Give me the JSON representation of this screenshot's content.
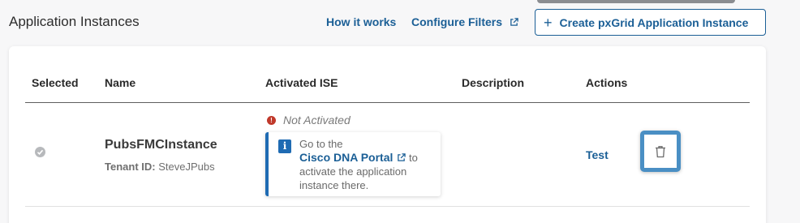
{
  "header": {
    "title": "Application Instances",
    "how_it_works": "How it works",
    "configure_filters": "Configure Filters",
    "create_button": "Create pxGrid Application Instance"
  },
  "table": {
    "columns": [
      "Selected",
      "Name",
      "Activated ISE",
      "Description",
      "Actions"
    ],
    "rows": [
      {
        "name": "PubsFMCInstance",
        "tenant_label": "Tenant ID:",
        "tenant_value": "SteveJPubs",
        "status": "Not Activated",
        "info_prefix": "Go to the",
        "info_link": "Cisco DNA Portal",
        "info_suffix": "to activate the application instance there.",
        "description": "",
        "action_test": "Test"
      }
    ]
  },
  "icons": {
    "external_link": "external-link-icon",
    "plus": "plus-icon",
    "check": "check-circle-icon",
    "warning": "error-icon",
    "info": "info-icon",
    "delete": "trash-icon"
  },
  "colors": {
    "link": "#1b5f96",
    "error": "#c0392b",
    "info_accent": "#1f6bb3",
    "highlight": "#4a8fc4"
  }
}
